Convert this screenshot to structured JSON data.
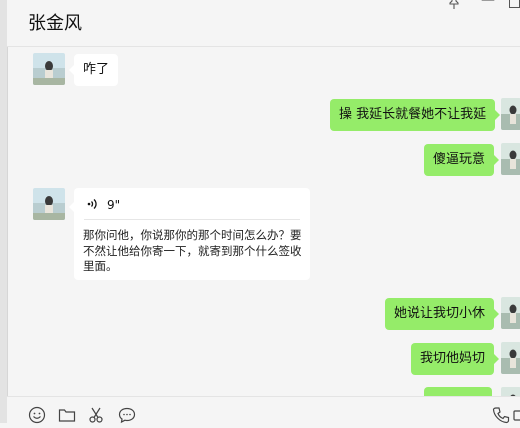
{
  "header": {
    "title": "张金风"
  },
  "messages": [
    {
      "side": "left",
      "type": "text",
      "text": "咋了"
    },
    {
      "side": "right",
      "type": "text",
      "text": "操 我延长就餐她不让我延"
    },
    {
      "side": "right",
      "type": "text",
      "text": "傻逼玩意"
    },
    {
      "side": "left",
      "type": "voice",
      "duration": "9\"",
      "transcript": "那你问他，你说那你的那个时间怎么办？要不然让他给你寄一下，就寄到那个什么签收里面。"
    },
    {
      "side": "right",
      "type": "text",
      "text": "她说让我切小休"
    },
    {
      "side": "right",
      "type": "text",
      "text": "我切他妈切"
    },
    {
      "side": "right",
      "type": "text",
      "text": ""
    }
  ],
  "toolbar": {
    "icons": [
      "emoji-icon",
      "folder-icon",
      "scissors-icon",
      "chat-bubble-icon",
      "phone-icon",
      "video-icon"
    ]
  },
  "colors": {
    "sent_bubble": "#95ec69",
    "received_bubble": "#ffffff",
    "background": "#f5f5f5"
  }
}
